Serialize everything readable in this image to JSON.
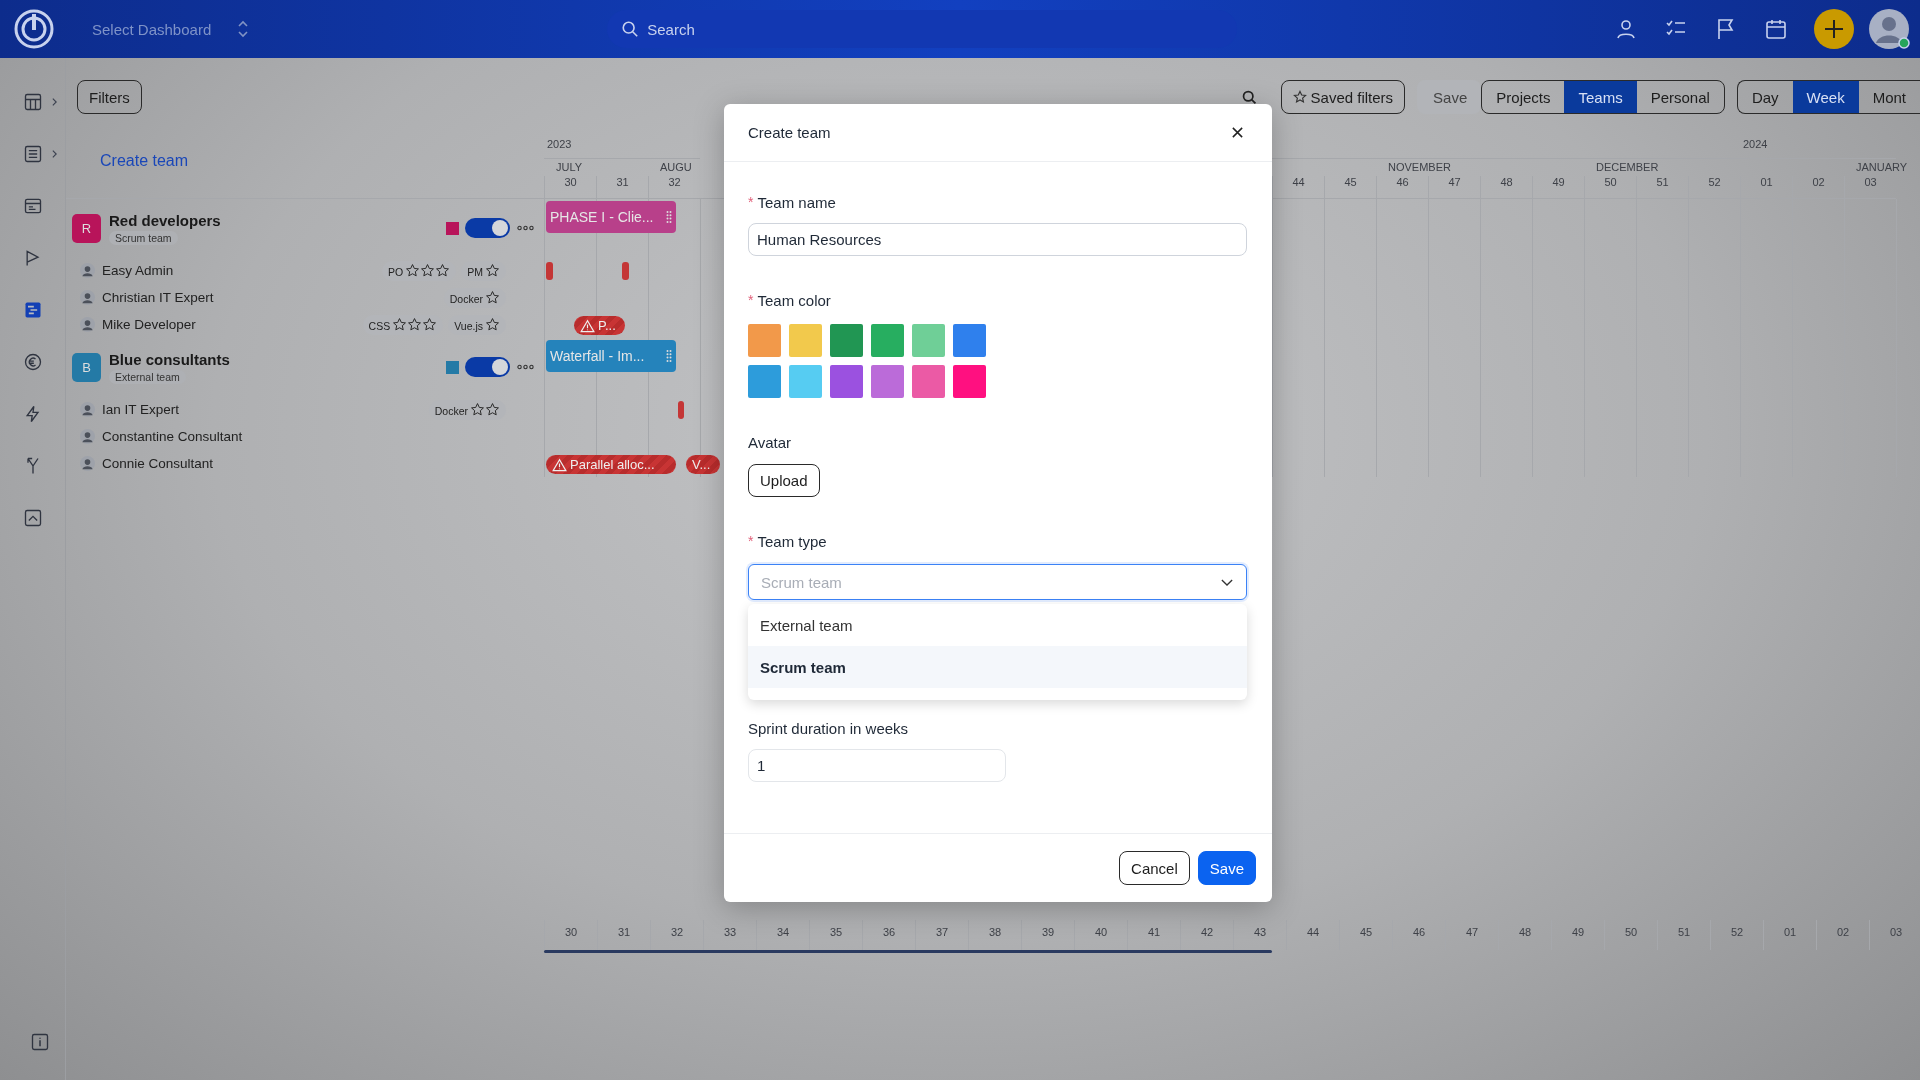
{
  "top_bar": {
    "dashboard_selector": "Select Dashboard",
    "search": {
      "placeholder": "Search"
    }
  },
  "sidebar": {
    "items": [
      {
        "kind": "dashboard",
        "has_submenu": true,
        "selected": false
      },
      {
        "kind": "list",
        "has_submenu": true,
        "selected": false
      },
      {
        "kind": "card",
        "has_submenu": false,
        "selected": false
      },
      {
        "kind": "flag",
        "has_submenu": false,
        "selected": false
      },
      {
        "kind": "gantt",
        "has_submenu": false,
        "selected": true
      },
      {
        "kind": "euro",
        "has_submenu": false,
        "selected": false
      },
      {
        "kind": "bolt",
        "has_submenu": false,
        "selected": false
      },
      {
        "kind": "fork",
        "has_submenu": false,
        "selected": false
      },
      {
        "kind": "chart",
        "has_submenu": false,
        "selected": false
      }
    ]
  },
  "toolbar": {
    "filters": "Filters",
    "saved_filters": "Saved filters",
    "save": "Save",
    "views": [
      {
        "label": "Projects",
        "selected": false
      },
      {
        "label": "Teams",
        "selected": true
      },
      {
        "label": "Personal",
        "selected": false
      }
    ],
    "scales": [
      {
        "label": "Day",
        "selected": false
      },
      {
        "label": "Week",
        "selected": true
      },
      {
        "label": "Mont",
        "selected": false
      }
    ]
  },
  "board": {
    "create_team": "Create team",
    "header_weeks_left": [
      {
        "week": "30",
        "month": "JULY",
        "year": "2023"
      },
      {
        "week": "31"
      },
      {
        "week": "32",
        "month": "AUGU"
      }
    ],
    "header_weeks_right": [
      {
        "week": "44"
      },
      {
        "week": "45"
      },
      {
        "week": "46",
        "month": "NOVEMBER"
      },
      {
        "week": "47"
      },
      {
        "week": "48"
      },
      {
        "week": "49"
      },
      {
        "week": "50",
        "month": "DECEMBER"
      },
      {
        "week": "51"
      },
      {
        "week": "52"
      },
      {
        "week": "01",
        "year": "2024"
      },
      {
        "week": "02"
      },
      {
        "week": "03",
        "month": "JANUARY"
      }
    ],
    "footer_weeks": [
      "30",
      "31",
      "32",
      "33",
      "34",
      "35",
      "36",
      "37",
      "38",
      "39",
      "40",
      "41",
      "42",
      "43",
      "44",
      "45",
      "46",
      "47",
      "48",
      "49",
      "50",
      "51",
      "52",
      "01",
      "02",
      "03"
    ],
    "rows": [
      {
        "kind": "team",
        "name": "Red developers",
        "type": "Scrum team",
        "initial": "R",
        "color": "#b8145a",
        "on": true,
        "items": [
          {
            "kind": "bar",
            "label": "PHASE I - Clie...",
            "color": "#b8408a"
          }
        ]
      },
      {
        "kind": "member",
        "name": "Easy Admin",
        "skills": [
          {
            "label": "PO",
            "rating": [
              {
                "filled": false
              },
              {
                "filled": false
              },
              {
                "filled": false
              }
            ]
          },
          {
            "label": "PM",
            "rating": [
              {
                "filled": false
              }
            ]
          }
        ],
        "items": [
          {
            "kind": "marker"
          },
          {
            "kind": "marker"
          }
        ]
      },
      {
        "kind": "member",
        "name": "Christian IT Expert",
        "skills": [
          {
            "label": "Docker",
            "rating": [
              {
                "filled": false
              }
            ]
          }
        ],
        "items": []
      },
      {
        "kind": "member",
        "name": "Mike Developer",
        "skills": [
          {
            "label": "CSS",
            "rating": [
              {
                "filled": false
              },
              {
                "filled": false
              },
              {
                "filled": false
              }
            ]
          },
          {
            "label": "Vue.js",
            "rating": [
              {
                "filled": false
              }
            ]
          }
        ],
        "items": [
          {
            "kind": "warning",
            "icon": true,
            "label": "P..."
          }
        ]
      },
      {
        "kind": "team",
        "name": "Blue consultants",
        "type": "External team",
        "initial": "B",
        "color": "#247aa6",
        "on": true,
        "items": [
          {
            "kind": "bar",
            "label": "Waterfall - Im...",
            "color": "#2583bb"
          }
        ]
      },
      {
        "kind": "member",
        "name": "Ian IT Expert",
        "skills": [
          {
            "label": "Docker",
            "rating": [
              {
                "filled": false
              },
              {
                "filled": false
              }
            ]
          }
        ],
        "items": [
          {
            "kind": "marker"
          }
        ]
      },
      {
        "kind": "member",
        "name": "Constantine Consultant",
        "skills": [],
        "items": []
      },
      {
        "kind": "member",
        "name": "Connie Consultant",
        "skills": [],
        "items": [
          {
            "kind": "warning",
            "icon": true,
            "label": "Parallel alloc..."
          },
          {
            "kind": "warning",
            "icon": false,
            "label": "V..."
          }
        ]
      }
    ]
  },
  "dialog": {
    "title": "Create team",
    "team_name": {
      "label": "Team name",
      "required_mark": "*",
      "value": "Human Resources"
    },
    "team_color": {
      "label": "Team color",
      "required_mark": "*"
    },
    "colors": [
      {
        "color": "#f2994a"
      },
      {
        "color": "#f2c94c"
      },
      {
        "color": "#219653"
      },
      {
        "color": "#27ae60"
      },
      {
        "color": "#6fcf97"
      },
      {
        "color": "#2f80ed"
      },
      {
        "color": "#2d9cdb"
      },
      {
        "color": "#56ccf2"
      },
      {
        "color": "#9b51e0"
      },
      {
        "color": "#bb6bd9"
      },
      {
        "color": "#eb5aa5"
      },
      {
        "color": "#ff1080"
      }
    ],
    "avatar": {
      "label": "Avatar",
      "button": "Upload"
    },
    "team_type": {
      "label": "Team type",
      "required_mark": "*",
      "placeholder": "Scrum team",
      "expanded": true,
      "options": [
        {
          "label": "External team",
          "selected": false
        },
        {
          "label": "Scrum team",
          "selected": true
        }
      ]
    },
    "sprint": {
      "label": "Sprint duration in weeks",
      "value": "1"
    },
    "buttons": {
      "cancel": "Cancel",
      "save": "Save"
    }
  }
}
